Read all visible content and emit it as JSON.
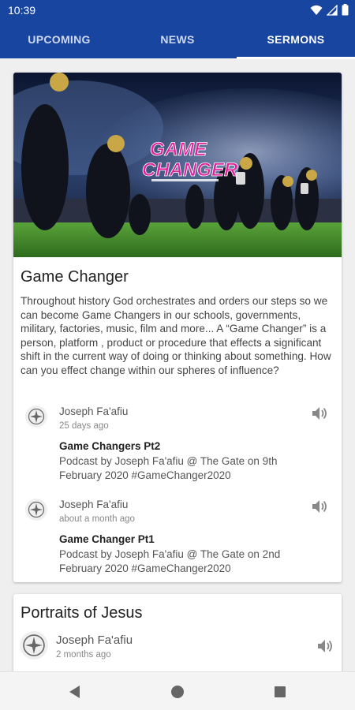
{
  "status_bar": {
    "time": "10:39"
  },
  "tabs": [
    {
      "label": "UPCOMING"
    },
    {
      "label": "NEWS"
    },
    {
      "label": "SERMONS",
      "active": true
    }
  ],
  "series": [
    {
      "title": "Game Changer",
      "artwork_text": [
        "GAME",
        "CHANGER"
      ],
      "description": "Throughout history God orchestrates and orders our steps so we can become Game Changers in our schools, governments, military, factories, music, film and more... A “Game Changer” is a person, platform , product or procedure that effects a significant shift in the current way of doing or thinking about something. How can you effect change within our spheres of influence?",
      "episodes": [
        {
          "author": "Joseph Fa'afiu",
          "time": "25 days ago",
          "title": "Game Changers Pt2",
          "description": "Podcast by Joseph Fa'afiu @ The Gate on 9th February 2020 #GameChanger2020"
        },
        {
          "author": "Joseph Fa'afiu",
          "time": "about a month ago",
          "title": "Game Changer Pt1",
          "description": "Podcast by Joseph Fa'afiu @ The Gate on 2nd February 2020 #GameChanger2020"
        }
      ]
    },
    {
      "title": "Portraits of Jesus",
      "episodes": [
        {
          "author": "Joseph Fa'afiu",
          "time": "2 months ago"
        }
      ]
    }
  ],
  "icons": {
    "wifi": "wifi-icon",
    "signal": "signal-icon",
    "battery": "battery-icon",
    "audio": "speaker-icon",
    "avatar": "church-logo-icon",
    "back": "back-triangle-icon",
    "home": "home-circle-icon",
    "recents": "recents-square-icon"
  },
  "colors": {
    "primary": "#1745a0",
    "artwork_title": "#e0219a"
  }
}
